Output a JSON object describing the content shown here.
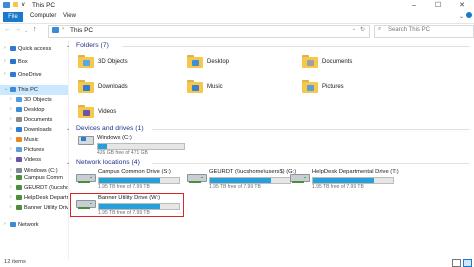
{
  "window": {
    "title": "This PC",
    "title_qa_marker": "∨"
  },
  "ribbon": {
    "tabs": [
      "File",
      "Computer",
      "View"
    ]
  },
  "address": {
    "path": "This PC",
    "search_placeholder": "Search This PC"
  },
  "nav": {
    "items": [
      {
        "label": "Quick access",
        "icon": "star-icon",
        "color": "#2f78d1"
      },
      {
        "label": "Box",
        "icon": "box-icon",
        "color": "#2574c7"
      },
      {
        "label": "OneDrive",
        "icon": "cloud-icon",
        "color": "#2a7cd6"
      },
      {
        "label": "This PC",
        "icon": "pc-icon",
        "color": "#3c8bd6"
      },
      {
        "label": "3D Objects",
        "icon": "cube-icon",
        "color": "#4d9de0"
      },
      {
        "label": "Desktop",
        "icon": "desktop-icon",
        "color": "#3b8fd8"
      },
      {
        "label": "Documents",
        "icon": "document-icon",
        "color": "#8a8a8a"
      },
      {
        "label": "Downloads",
        "icon": "download-icon",
        "color": "#2b7fd4"
      },
      {
        "label": "Music",
        "icon": "music-icon",
        "color": "#e38a25"
      },
      {
        "label": "Pictures",
        "icon": "picture-icon",
        "color": "#5aa0d8"
      },
      {
        "label": "Videos",
        "icon": "video-icon",
        "color": "#6b55a8"
      },
      {
        "label": "Windows (C:)",
        "icon": "drive-icon",
        "color": "#7d8a96"
      },
      {
        "label": "GEURDT (\\\\ucshome\\",
        "icon": "network-drive-icon",
        "color": "#4b8f3a"
      },
      {
        "label": "Campus Comm",
        "icon": "network-drive-icon",
        "color": "#4b8f3a"
      },
      {
        "label": "HelpDesk Departme",
        "icon": "network-drive-icon",
        "color": "#4b8f3a"
      },
      {
        "label": "Banner Utility Drive",
        "icon": "network-drive-icon",
        "color": "#4b8f3a"
      },
      {
        "label": "Network",
        "icon": "network-icon",
        "color": "#3c8bd6"
      }
    ]
  },
  "sections": {
    "folders": "Folders (7)",
    "devices": "Devices and drives (1)",
    "network": "Network locations (4)"
  },
  "folders": [
    {
      "name": "3D Objects",
      "icon": "cube-icon",
      "color": "#5aa7e6"
    },
    {
      "name": "Desktop",
      "icon": "desktop-icon",
      "color": "#3f8fd9"
    },
    {
      "name": "Documents",
      "icon": "document-icon",
      "color": "#9aa0a6"
    },
    {
      "name": "Downloads",
      "icon": "download-icon",
      "color": "#2b7fd4"
    },
    {
      "name": "Music",
      "icon": "music-icon",
      "color": "#3a7fd0"
    },
    {
      "name": "Pictures",
      "icon": "picture-icon",
      "color": "#5aa0d8"
    },
    {
      "name": "Videos",
      "icon": "video-icon",
      "color": "#6b55a8"
    }
  ],
  "devices": [
    {
      "name": "Windows (C:)",
      "free": "426 GB free of 471 GB",
      "used_fraction": 0.1
    }
  ],
  "network_locations": [
    {
      "name": "Campus Common Drive (S:)",
      "free": "1.95 TB free of 7.99 TB",
      "used_fraction": 0.76
    },
    {
      "name": "GEURDT (\\\\ucshome\\users$) (G:)",
      "free": "1.95 TB free of 7.99 TB",
      "used_fraction": 0.76
    },
    {
      "name": "HelpDesk Departmental Drive (T:)",
      "free": "1.95 TB free of 7.99 TB",
      "used_fraction": 0.76
    },
    {
      "name": "Banner Utility Drive (W:)",
      "free": "1.95 TB free of 7.99 TB",
      "used_fraction": 0.76
    }
  ],
  "status": {
    "items": "12 items"
  },
  "colors": {
    "accent": "#1979ca",
    "selection": "#cce8ff",
    "highlight": "#d9262b",
    "bar_fill": "#26a0da"
  }
}
